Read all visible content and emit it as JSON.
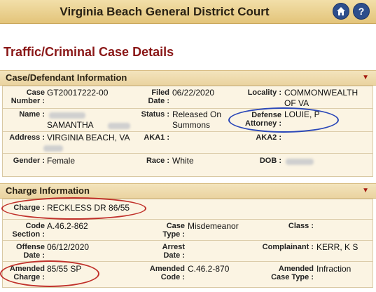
{
  "header": {
    "court_name": "Virginia Beach General District Court",
    "home_icon": "home-icon",
    "help_label": "?"
  },
  "page_title": "Traffic/Criminal Case Details",
  "case_section": {
    "title": "Case/Defendant Information",
    "toggle": "▼",
    "case_number_label": "Case Number :",
    "case_number": "GT20017222-00",
    "filed_date_label": "Filed Date :",
    "filed_date": "06/22/2020",
    "locality_label": "Locality :",
    "locality": "COMMONWEALTH OF VA",
    "name_label": "Name :",
    "name": "SAMANTHA",
    "status_label": "Status :",
    "status": "Released On Summons",
    "defense_attorney_label": "Defense Attorney :",
    "defense_attorney": "LOUIE, P",
    "address_label": "Address :",
    "address": "VIRGINIA BEACH, VA",
    "aka1_label": "AKA1 :",
    "aka2_label": "AKA2 :",
    "gender_label": "Gender :",
    "gender": "Female",
    "race_label": "Race :",
    "race": "White",
    "dob_label": "DOB :"
  },
  "charge_section": {
    "title": "Charge Information",
    "toggle": "▼",
    "charge_label": "Charge :",
    "charge": "RECKLESS DR 86/55",
    "code_section_label": "Code Section :",
    "code_section": "A.46.2-862",
    "case_type_label": "Case Type :",
    "case_type": "Misdemeanor",
    "class_label": "Class :",
    "offense_date_label": "Offense Date :",
    "offense_date": "06/12/2020",
    "arrest_date_label": "Arrest Date :",
    "complainant_label": "Complainant :",
    "complainant": "KERR, K S",
    "amended_charge_label": "Amended Charge :",
    "amended_charge": "85/55 SP",
    "amended_code_label": "Amended Code :",
    "amended_code": "C.46.2-870",
    "amended_case_type_label": "Amended Case Type :",
    "amended_case_type": "Infraction"
  },
  "annotation_color": "#c0302a",
  "highlight_color": "#2a47b8"
}
